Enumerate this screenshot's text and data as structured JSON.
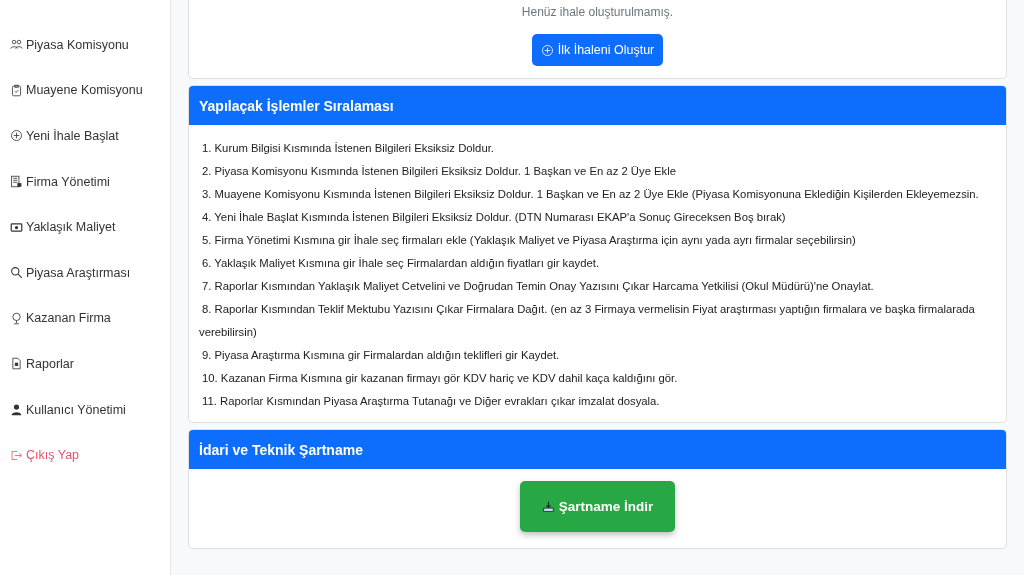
{
  "sidebar": {
    "items": [
      {
        "label": "Piyasa Komisyonu",
        "kind": "nav"
      },
      {
        "label": "Muayene Komisyonu",
        "kind": "nav"
      },
      {
        "label": "Yeni İhale Başlat",
        "kind": "nav"
      },
      {
        "label": "Firma Yönetimi",
        "kind": "nav"
      },
      {
        "label": "Yaklaşık Maliyet",
        "kind": "nav"
      },
      {
        "label": "Piyasa Araştırması",
        "kind": "nav"
      },
      {
        "label": "Kazanan Firma",
        "kind": "nav"
      },
      {
        "label": "Raporlar",
        "kind": "nav"
      },
      {
        "label": "Kullanıcı Yönetimi",
        "kind": "nav"
      },
      {
        "label": "Çıkış Yap",
        "kind": "logout"
      }
    ]
  },
  "tenders_card": {
    "empty_text": "Henüz ihale oluşturulmamış.",
    "button": "İlk İhaleni Oluştur"
  },
  "steps_card": {
    "title": "Yapılaçak İşlemler Sıralaması",
    "steps": [
      "1. Kurum Bilgisi Kısmında İstenen Bilgileri Eksiksiz Doldur.",
      "2. Piyasa Komisyonu Kısmında İstenen Bilgileri Eksiksiz Doldur. 1 Başkan ve En az 2 Üye Ekle",
      "3. Muayene Komisyonu Kısmında İstenen Bilgileri Eksiksiz Doldur. 1 Başkan ve En az 2 Üye Ekle (Piyasa Komisyonuna Eklediğin Kişilerden Ekleyemezsin.",
      "4. Yeni İhale Başlat Kısmında İstenen Bilgileri Eksiksiz Doldur. (DTN Numarası EKAP'a Sonuç Gireceksen Boş bırak)",
      "5. Firma Yönetimi Kısmına gir İhale seç firmaları ekle (Yaklaşık Maliyet ve Piyasa Araştırma için aynı yada ayrı firmalar seçebilirsin)",
      "6. Yaklaşık Maliyet Kısmına gir İhale seç Firmalardan aldığın fiyatları gir kaydet.",
      "7. Raporlar Kısmından Yaklaşık Maliyet Cetvelini ve Doğrudan Temin Onay Yazısını Çıkar Harcama Yetkilisi (Okul Müdürü)'ne Onaylat.",
      "8. Raporlar Kısmından Teklif Mektubu Yazısını Çıkar Firmalara Dağıt. (en az 3 Firmaya vermelisin Fiyat araştırması yaptığın firmalara ve başka firmalarada verebilirsin)",
      "9. Piyasa Araştırma Kısmına gir Firmalardan aldığın teklifleri gir Kaydet.",
      "10. Kazanan Firma Kısmına gir kazanan firmayı gör KDV hariç ve KDV dahil kaça kaldığını gör.",
      "11. Raporlar Kısmından Piyasa Araştırma Tutanağı ve Diğer evrakları çıkar imzalat dosyala."
    ]
  },
  "spec_card": {
    "title": "İdari ve Teknik Şartname",
    "button": "Şartname İndir"
  }
}
